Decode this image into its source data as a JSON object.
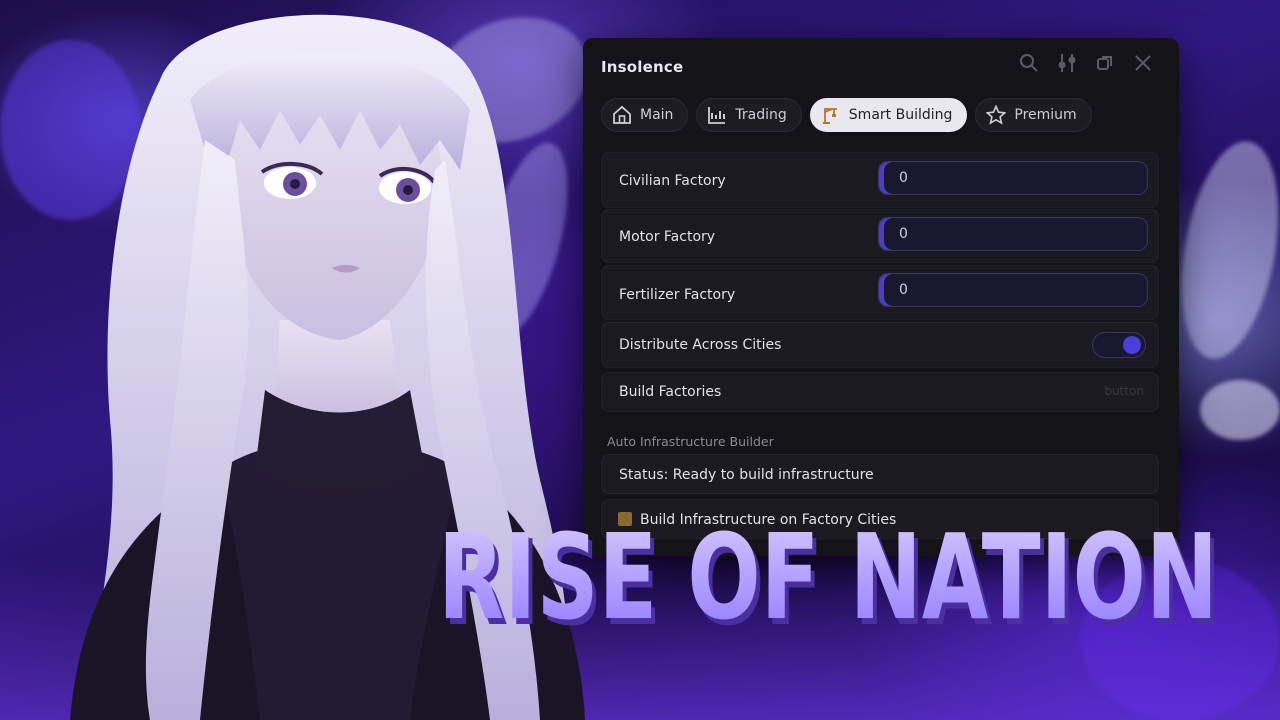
{
  "window": {
    "title": "Insolence",
    "controls": [
      "search-icon",
      "settings-sliders-icon",
      "restore-icon",
      "close-icon"
    ]
  },
  "tabs": [
    {
      "label": "Main",
      "icon": "home-icon",
      "active": false
    },
    {
      "label": "Trading",
      "icon": "chart-icon",
      "active": false
    },
    {
      "label": "Smart Building",
      "icon": "crane-icon",
      "active": true
    },
    {
      "label": "Premium",
      "icon": "star-icon",
      "active": false
    }
  ],
  "factories": [
    {
      "label": "Civilian Factory",
      "value": "0"
    },
    {
      "label": "Motor Factory",
      "value": "0"
    },
    {
      "label": "Fertilizer Factory",
      "value": "0"
    }
  ],
  "distribute": {
    "label": "Distribute Across Cities",
    "enabled": true
  },
  "build_factories": {
    "label": "Build Factories",
    "hint": "button"
  },
  "infrastructure": {
    "section_title": "Auto Infrastructure Builder",
    "status": "Status: Ready to build infrastructure",
    "build_button": "Build Infrastructure on Factory Cities"
  },
  "headline": "RISE OF NATION",
  "colors": {
    "accent": "#4a3fd8",
    "panel": "#141318",
    "headline_fill": "#b9a6ff"
  }
}
